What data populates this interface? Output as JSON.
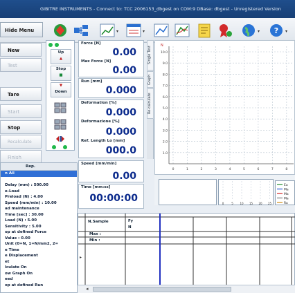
{
  "window": {
    "title": "GIBITRE INSTRUMENTS - Connect to: TCC 2006153_dbgest on COM:9    DBase: dbgest  - Unregistered Version"
  },
  "toolbar": {
    "menu_label": "Hide Menu",
    "icons": [
      "machine-icon",
      "network-icon",
      "chart-icon",
      "graph-settings-icon",
      "line-chart-icon",
      "multi-chart-icon",
      "notes-icon",
      "award-icon",
      "globe-icon",
      "help-icon"
    ]
  },
  "left_buttons": [
    {
      "label": "New",
      "enabled": true
    },
    {
      "label": "Test",
      "enabled": false
    },
    {
      "label": "Tare",
      "enabled": true
    },
    {
      "label": "Start",
      "enabled": false
    },
    {
      "label": "Stop",
      "enabled": true
    },
    {
      "label": "Recalculate",
      "enabled": false
    },
    {
      "label": "Finish",
      "enabled": false
    }
  ],
  "motor": {
    "up": "Up",
    "stop": "Stop",
    "down": "Down"
  },
  "readouts": {
    "force": {
      "label": "Force [N]",
      "value": "0.00"
    },
    "max_force": {
      "label": "Max Force [N]",
      "value": "0.00"
    },
    "run": {
      "label": "Run [mm]",
      "value": "0.000"
    },
    "deformation_pct": {
      "label": "Deformation [%]",
      "value": "0.000"
    },
    "deformazione_pct": {
      "label": "Deformazione [%]",
      "value": "0.000"
    },
    "ref_length": {
      "label": "Ref. Length Lo [mm]",
      "value": "000.0"
    },
    "speed": {
      "label": "Speed [mm/min]",
      "value": "0.00"
    },
    "time": {
      "label": "Time [mm:ss]",
      "value": "00:00:00"
    }
  },
  "vtabs": [
    "Single Test",
    "Graph",
    "Re-calculate"
  ],
  "chart_data": {
    "type": "line",
    "ylabel": "N",
    "y_ticks": [
      "10.0",
      "9.0",
      "8.0",
      "7.0",
      "6.0",
      "5.0",
      "4.0",
      "3.0",
      "2.0",
      "1.0"
    ],
    "x_ticks": [
      "0",
      "1",
      "2",
      "3",
      "4",
      "5",
      "6",
      "7",
      "8"
    ],
    "series": []
  },
  "small_chart": {
    "y_tick": "0",
    "x_ticks": [
      "0",
      "5",
      "10",
      "15",
      "20",
      "25"
    ],
    "legend": [
      {
        "name": "Ea",
        "color": "#1a8a2a"
      },
      {
        "name": "Ma",
        "color": "#1f4fd0"
      },
      {
        "name": "Ma",
        "color": "#d22222"
      },
      {
        "name": "Ma",
        "color": "#777777"
      },
      {
        "name": "Ru",
        "color": "#d08a10"
      }
    ]
  },
  "params": {
    "header": "Rep.",
    "rows": [
      "n All",
      "",
      "Delay (mm) : 500.00",
      "e-Load",
      "Preload (N) : 4.00",
      "Speed (mm/min) : 10.00",
      "ad maintenance",
      "Time [sec] : 30.00",
      "Load (N) : 5.00",
      "Sensitivity : 5.00",
      "op at defined Force",
      "Value : 0.00",
      "Unit (0=N, 1=N/mm2, 2=",
      "e Time",
      "e Displacement",
      "et",
      "lculate On",
      "ow Graph On",
      "eed",
      "op at defined Run"
    ]
  },
  "results": {
    "col_sample": "N.Sample",
    "col_fy": "Fy",
    "col_fy_unit": "N",
    "rows": [
      {
        "label": "Max :"
      },
      {
        "label": "Min :"
      }
    ]
  }
}
